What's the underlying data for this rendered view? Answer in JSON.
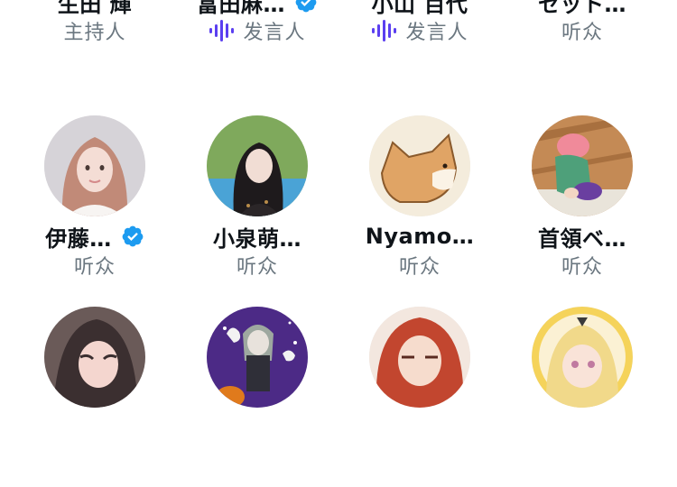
{
  "colors": {
    "text_primary": "#0f1419",
    "text_secondary": "#6b7780",
    "verified_blue": "#1d9bf0",
    "speaking_purple": "#5b3ff0"
  },
  "participants": [
    {
      "name": "生田 輝",
      "role": "主持人",
      "verified": false,
      "speaking": false,
      "avatar_icon": "person-photo-avatar"
    },
    {
      "name": "富田麻…",
      "role": "发言人",
      "verified": true,
      "speaking": true,
      "avatar_icon": "group-photo-avatar"
    },
    {
      "name": "小山 百代",
      "role": "发言人",
      "verified": false,
      "speaking": true,
      "avatar_icon": "person-photo-avatar"
    },
    {
      "name": "セット…",
      "role": "听众",
      "verified": false,
      "speaking": false,
      "avatar_icon": "sketch-drawing-avatar"
    },
    {
      "name": "伊藤…",
      "role": "听众",
      "verified": true,
      "speaking": false,
      "avatar_icon": "girl-photo-avatar"
    },
    {
      "name": "小泉萌…",
      "role": "听众",
      "verified": false,
      "speaking": false,
      "avatar_icon": "girl-photo-avatar"
    },
    {
      "name": "Nyamo…",
      "role": "听众",
      "verified": false,
      "speaking": false,
      "avatar_icon": "shiba-dog-illustration-avatar"
    },
    {
      "name": "首領ベ…",
      "role": "听众",
      "verified": false,
      "speaking": false,
      "avatar_icon": "anime-character-avatar"
    },
    {
      "name": "",
      "role": "",
      "verified": false,
      "speaking": false,
      "avatar_icon": "anime-girl-avatar"
    },
    {
      "name": "",
      "role": "",
      "verified": false,
      "speaking": false,
      "avatar_icon": "halloween-anime-avatar"
    },
    {
      "name": "",
      "role": "",
      "verified": false,
      "speaking": false,
      "avatar_icon": "red-hair-anime-avatar"
    },
    {
      "name": "",
      "role": "",
      "verified": false,
      "speaking": false,
      "avatar_icon": "blonde-anime-avatar"
    }
  ]
}
